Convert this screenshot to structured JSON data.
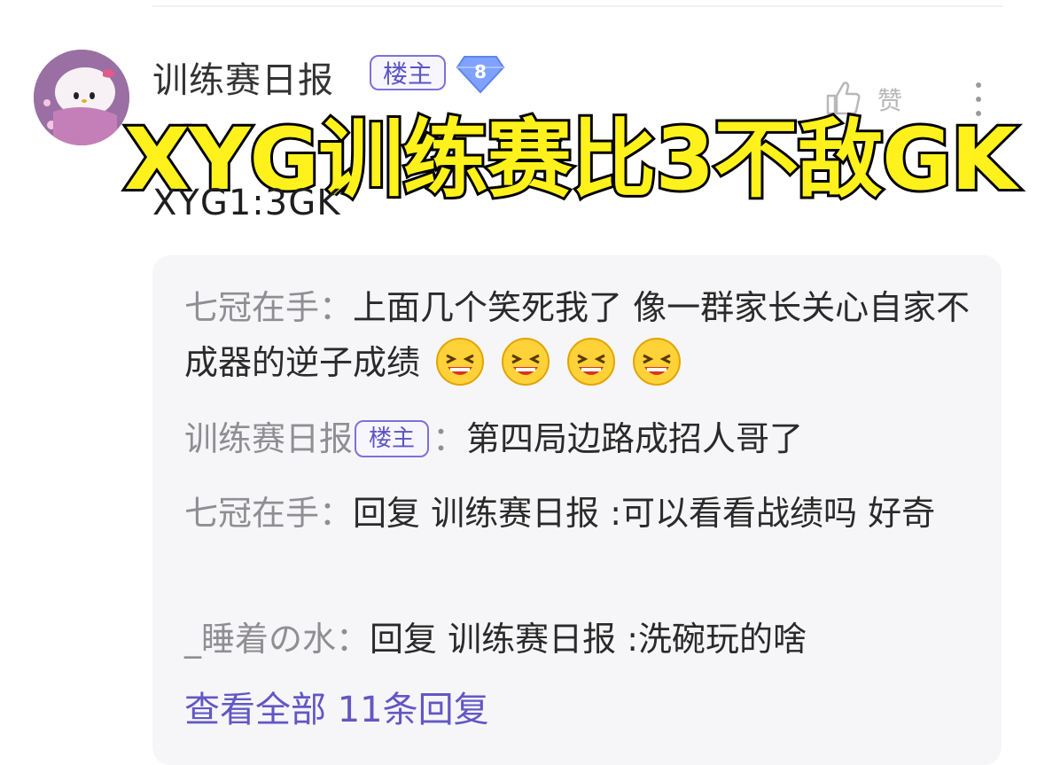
{
  "post": {
    "username": "训练赛日报",
    "host_badge": "楼主",
    "level": "8",
    "like_label": "赞",
    "subline": "",
    "body": "XYG1:3GK"
  },
  "overlay": {
    "title": "XYG训练赛比3不敌GK",
    "color": "#fff21c"
  },
  "replies": [
    {
      "name": "七冠在手",
      "sep": "：",
      "text": "上面几个笑死我了 像一群家长关心自家不成器的逆子成绩",
      "emoji_count": 4
    },
    {
      "name": "训练赛日报",
      "badge": "楼主",
      "sep": "：",
      "text": "第四局边路成招人哥了"
    },
    {
      "name": "七冠在手",
      "sep": "：",
      "text": "回复 训练赛日报 :可以看看战绩吗 好奇"
    },
    {
      "name": "_睡着の水",
      "sep": "：",
      "text": "回复 训练赛日报 :洗碗玩的啥"
    }
  ],
  "view_all": "查看全部 11条回复",
  "colors": {
    "accent": "#6257c4",
    "reply_bg": "#f6f6f8",
    "name_gray": "#8e8e93"
  }
}
